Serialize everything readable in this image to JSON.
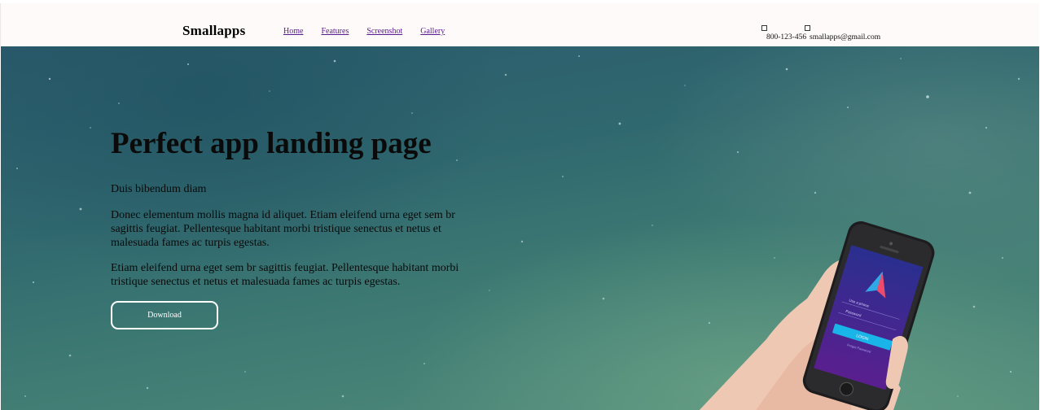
{
  "header": {
    "brand": "Smallapps",
    "nav": [
      {
        "label": "Home"
      },
      {
        "label": "Features"
      },
      {
        "label": "Screenshot"
      },
      {
        "label": "Gallery"
      }
    ],
    "phone": "800-123-456",
    "email": "smallapps@gmail.com",
    "phone_icon": "broken-image-icon",
    "email_icon": "broken-image-icon"
  },
  "hero": {
    "title": "Perfect app landing page",
    "subtitle": "Duis bibendum diam",
    "paragraph1": "Donec elementum mollis magna id aliquet. Etiam eleifend urna eget sem br sagittis feugiat. Pellentesque habitant morbi tristique senectus et netus et malesuada fames ac turpis egestas.",
    "paragraph2": "Etiam eleifend urna eget sem br sagittis feugiat. Pellentesque habitant morbi tristique senectus et netus et malesuada fames ac turpis egestas.",
    "download_label": "Download",
    "phone_screen": {
      "field1": "Use a phone",
      "field2": "Password",
      "login_label": "LOGIN",
      "forgot_label": "Forgot Password"
    }
  },
  "colors": {
    "header_bg": "#fffafa",
    "hero_start": "#2a5a6c",
    "hero_end": "#558e7c",
    "link": "#551a8b",
    "button_border": "#ffffff",
    "screen_purple": "#3b2a8a",
    "screen_cyan": "#19b4e8"
  }
}
